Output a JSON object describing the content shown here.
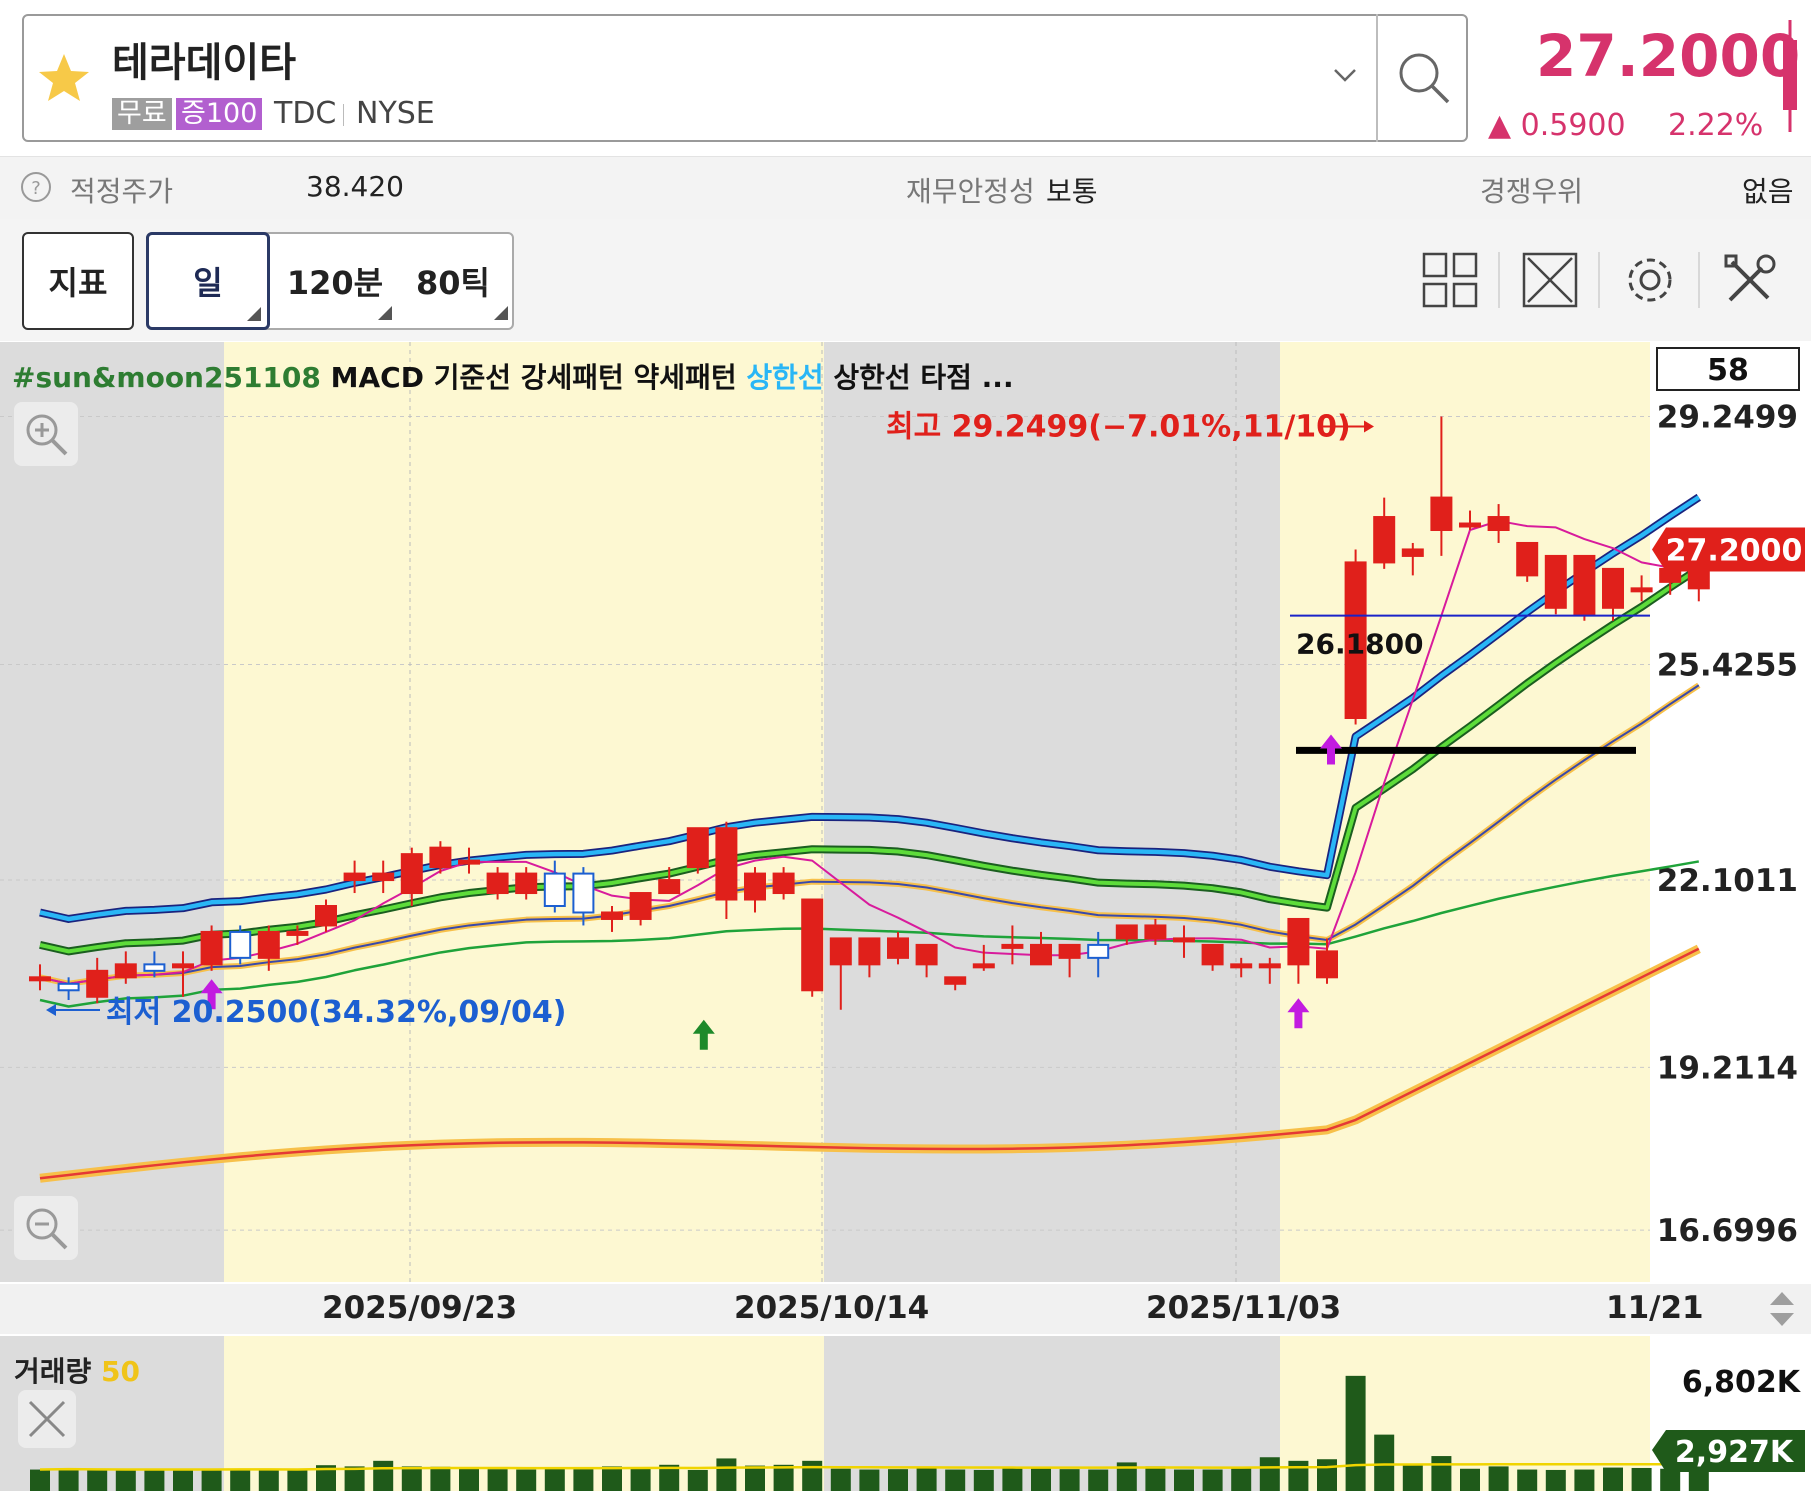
{
  "header": {
    "stock_name": "테라데이타",
    "tag_free": "무료",
    "tag_margin": "증100",
    "ticker": "TDC",
    "exchange": "NYSE",
    "price": "27.2000",
    "change": "0.5900",
    "change_pct": "2.22%",
    "price_color": "#d6336c"
  },
  "info": {
    "fair_label": "적정주가",
    "fair_value": "38.420",
    "stability_label": "재무안정성",
    "stability_value": "보통",
    "advantage_label": "경쟁우위",
    "advantage_value": "없음"
  },
  "toolbar": {
    "indicator": "지표",
    "day": "일",
    "min120": "120분",
    "tick80": "80틱",
    "icons": [
      "grid-layout-icon",
      "expand-icon",
      "gear-icon",
      "tools-icon"
    ]
  },
  "legend": {
    "sunmoon": "#sun&moon251108",
    "macd": "MACD",
    "base": "기준선",
    "strong": "강세패턴",
    "weak": "약세패턴",
    "upper": "상한선",
    "upper_hit": "상한선 타점 ..."
  },
  "annotations": {
    "high": "최고 29.2499(−7.01%,11/10)",
    "low": "최저 20.2500(34.32%,09/04)",
    "level": "26.1800",
    "count_box": "58",
    "price_tag": "27.2000"
  },
  "chart_data": {
    "type": "candlestick",
    "y_ticks": [
      "29.2499",
      "25.4255",
      "22.1011",
      "19.2114",
      "16.6996"
    ],
    "x_ticks": [
      "2025/09/23",
      "2025/10/14",
      "2025/11/03",
      "11/21"
    ],
    "ylim": [
      15.9,
      30.4
    ],
    "grid": true,
    "candles": [
      {
        "o": 20.6,
        "h": 20.8,
        "l": 20.4,
        "c": 20.6
      },
      {
        "o": 20.5,
        "h": 20.6,
        "l": 20.25,
        "c": 20.4
      },
      {
        "o": 20.3,
        "h": 20.9,
        "l": 20.2,
        "c": 20.7
      },
      {
        "o": 20.6,
        "h": 21.0,
        "l": 20.5,
        "c": 20.8
      },
      {
        "o": 20.8,
        "h": 21.0,
        "l": 20.6,
        "c": 20.7
      },
      {
        "o": 20.8,
        "h": 21.0,
        "l": 20.3,
        "c": 20.8
      },
      {
        "o": 20.8,
        "h": 21.4,
        "l": 20.7,
        "c": 21.3
      },
      {
        "o": 21.3,
        "h": 21.4,
        "l": 20.8,
        "c": 20.9
      },
      {
        "o": 20.9,
        "h": 21.4,
        "l": 20.7,
        "c": 21.3
      },
      {
        "o": 21.3,
        "h": 21.4,
        "l": 21.1,
        "c": 21.3
      },
      {
        "o": 21.4,
        "h": 21.8,
        "l": 21.3,
        "c": 21.7
      },
      {
        "o": 22.1,
        "h": 22.4,
        "l": 21.9,
        "c": 22.2
      },
      {
        "o": 22.1,
        "h": 22.4,
        "l": 21.9,
        "c": 22.2
      },
      {
        "o": 21.9,
        "h": 22.6,
        "l": 21.7,
        "c": 22.5
      },
      {
        "o": 22.3,
        "h": 22.7,
        "l": 22.2,
        "c": 22.6
      },
      {
        "o": 22.4,
        "h": 22.6,
        "l": 22.2,
        "c": 22.4
      },
      {
        "o": 21.9,
        "h": 22.3,
        "l": 21.8,
        "c": 22.2
      },
      {
        "o": 21.9,
        "h": 22.3,
        "l": 21.8,
        "c": 22.2
      },
      {
        "o": 22.2,
        "h": 22.4,
        "l": 21.6,
        "c": 21.7
      },
      {
        "o": 22.2,
        "h": 22.3,
        "l": 21.4,
        "c": 21.6
      },
      {
        "o": 21.5,
        "h": 21.7,
        "l": 21.3,
        "c": 21.6
      },
      {
        "o": 21.5,
        "h": 21.8,
        "l": 21.4,
        "c": 21.9
      },
      {
        "o": 21.9,
        "h": 22.3,
        "l": 21.9,
        "c": 22.1
      },
      {
        "o": 22.3,
        "h": 22.9,
        "l": 22.2,
        "c": 22.9
      },
      {
        "o": 21.8,
        "h": 23.0,
        "l": 21.5,
        "c": 22.9
      },
      {
        "o": 21.8,
        "h": 22.3,
        "l": 21.6,
        "c": 22.2
      },
      {
        "o": 21.9,
        "h": 22.3,
        "l": 21.8,
        "c": 22.2
      },
      {
        "o": 20.4,
        "h": 21.8,
        "l": 20.3,
        "c": 21.8
      },
      {
        "o": 20.8,
        "h": 21.1,
        "l": 20.1,
        "c": 21.2
      },
      {
        "o": 20.8,
        "h": 21.2,
        "l": 20.6,
        "c": 21.2
      },
      {
        "o": 20.9,
        "h": 21.3,
        "l": 20.8,
        "c": 21.2
      },
      {
        "o": 20.8,
        "h": 21.1,
        "l": 20.6,
        "c": 21.1
      },
      {
        "o": 20.5,
        "h": 20.6,
        "l": 20.4,
        "c": 20.6
      },
      {
        "o": 20.8,
        "h": 21.1,
        "l": 20.7,
        "c": 20.8
      },
      {
        "o": 21.1,
        "h": 21.4,
        "l": 20.8,
        "c": 21.1
      },
      {
        "o": 20.8,
        "h": 21.3,
        "l": 20.8,
        "c": 21.1
      },
      {
        "o": 20.9,
        "h": 21.1,
        "l": 20.6,
        "c": 21.1
      },
      {
        "o": 21.1,
        "h": 21.3,
        "l": 20.6,
        "c": 20.9
      },
      {
        "o": 21.2,
        "h": 21.4,
        "l": 21.1,
        "c": 21.4
      },
      {
        "o": 21.2,
        "h": 21.5,
        "l": 21.1,
        "c": 21.4
      },
      {
        "o": 21.2,
        "h": 21.4,
        "l": 20.9,
        "c": 21.2
      },
      {
        "o": 20.8,
        "h": 21.1,
        "l": 20.7,
        "c": 21.1
      },
      {
        "o": 20.8,
        "h": 20.9,
        "l": 20.6,
        "c": 20.8
      },
      {
        "o": 20.8,
        "h": 20.9,
        "l": 20.5,
        "c": 20.8
      },
      {
        "o": 20.8,
        "h": 21.5,
        "l": 20.5,
        "c": 21.5
      },
      {
        "o": 20.6,
        "h": 21.2,
        "l": 20.5,
        "c": 21.0
      },
      {
        "o": 24.6,
        "h": 27.2,
        "l": 24.5,
        "c": 27.0
      },
      {
        "o": 27.0,
        "h": 28.0,
        "l": 26.9,
        "c": 27.7
      },
      {
        "o": 27.1,
        "h": 27.3,
        "l": 26.8,
        "c": 27.2
      },
      {
        "o": 27.5,
        "h": 29.2499,
        "l": 27.1,
        "c": 28.0
      },
      {
        "o": 27.6,
        "h": 27.8,
        "l": 27.5,
        "c": 27.6
      },
      {
        "o": 27.5,
        "h": 27.9,
        "l": 27.3,
        "c": 27.7
      },
      {
        "o": 26.8,
        "h": 27.3,
        "l": 26.7,
        "c": 27.3
      },
      {
        "o": 26.3,
        "h": 27.1,
        "l": 26.2,
        "c": 27.1
      },
      {
        "o": 26.2,
        "h": 27.1,
        "l": 26.1,
        "c": 27.1
      },
      {
        "o": 26.3,
        "h": 26.9,
        "l": 26.1,
        "c": 26.9
      },
      {
        "o": 26.6,
        "h": 26.8,
        "l": 26.4,
        "c": 26.6
      },
      {
        "o": 26.7,
        "h": 27.4,
        "l": 26.5,
        "c": 26.9
      },
      {
        "o": 26.6,
        "h": 27.2,
        "l": 26.4,
        "c": 27.2
      }
    ],
    "volume": {
      "label": "거래량",
      "period": "50",
      "y_ticks": [
        "6,802K"
      ],
      "tag": "2,927K",
      "values": [
        540,
        560,
        530,
        530,
        550,
        540,
        550,
        560,
        540,
        530,
        650,
        620,
        760,
        620,
        610,
        600,
        550,
        540,
        580,
        550,
        620,
        600,
        660,
        530,
        820,
        640,
        660,
        760,
        560,
        540,
        550,
        570,
        540,
        530,
        570,
        580,
        550,
        540,
        720,
        620,
        540,
        540,
        570,
        850,
        760,
        800,
        2900,
        1420,
        650,
        880,
        560,
        620,
        540,
        530,
        540,
        590,
        580,
        560,
        1200
      ],
      "max": 3400
    }
  }
}
